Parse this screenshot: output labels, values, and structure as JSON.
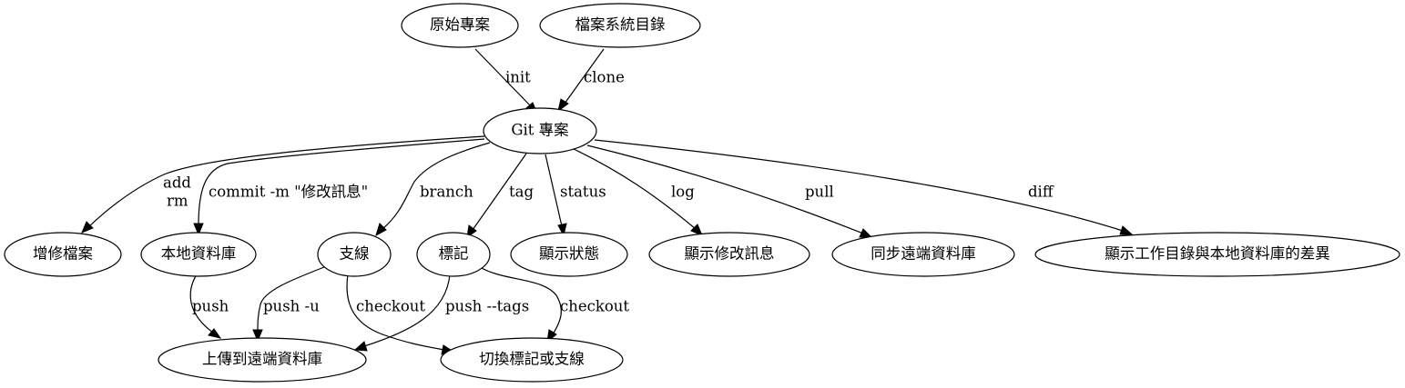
{
  "nodes": {
    "original_project": "原始專案",
    "filesystem_dir": "檔案系統目錄",
    "git_project": "Git 專案",
    "add_files": "增修檔案",
    "local_repo": "本地資料庫",
    "branch": "支線",
    "tag": "標記",
    "show_status": "顯示狀態",
    "show_log": "顯示修改訊息",
    "sync_remote": "同步遠端資料庫",
    "show_diff": "顯示工作目錄與本地資料庫的差異",
    "upload_remote": "上傳到遠端資料庫",
    "switch_tag_branch": "切換標記或支線"
  },
  "edges": {
    "init": "init",
    "clone": "clone",
    "add": "add",
    "rm": "rm",
    "commit": "commit -m \"修改訊息\"",
    "branch": "branch",
    "tag": "tag",
    "status": "status",
    "log": "log",
    "pull": "pull",
    "diff": "diff",
    "push": "push",
    "push_u": "push -u",
    "checkout_branch": "checkout",
    "push_tags": "push --tags",
    "checkout_tag": "checkout"
  },
  "colors": {
    "line": "#000000",
    "fill": "#ffffff",
    "text": "#000000"
  }
}
